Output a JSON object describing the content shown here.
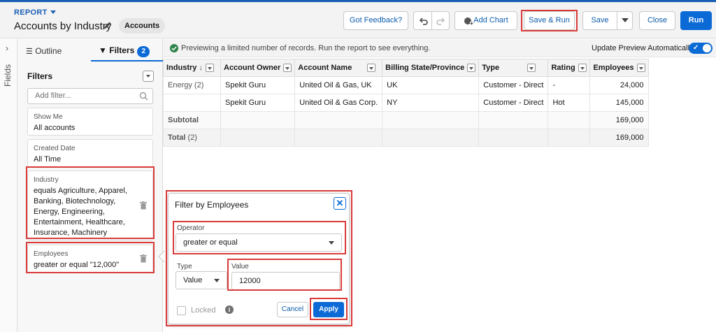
{
  "header": {
    "object_label": "REPORT",
    "title": "Accounts by Industry",
    "report_type": "Accounts",
    "buttons": {
      "feedback": "Got Feedback?",
      "add_chart": "Add Chart",
      "save_run": "Save & Run",
      "save": "Save",
      "close": "Close",
      "run": "Run"
    }
  },
  "rail": {
    "label": "Fields"
  },
  "panel": {
    "tabs": {
      "outline": "Outline",
      "filters": "Filters",
      "filter_count": "2"
    },
    "filters_heading": "Filters",
    "add_filter_placeholder": "Add filter...",
    "cards": [
      {
        "label": "Show Me",
        "value": "All accounts"
      },
      {
        "label": "Created Date",
        "value": "All Time"
      },
      {
        "label": "Industry",
        "value": "equals Agriculture, Apparel, Banking, Biotechnology, Energy, Engineering, Entertainment, Healthcare, Insurance, Machinery"
      },
      {
        "label": "Employees",
        "value": "greater or equal \"12,000\""
      }
    ]
  },
  "preview": {
    "message": "Previewing a limited number of records. Run the report to see everything.",
    "auto_label": "Update Preview Automatically"
  },
  "table": {
    "columns": [
      "Industry",
      "Account Owner",
      "Account Name",
      "Billing State/Province",
      "Type",
      "Rating",
      "Employees"
    ],
    "rows": [
      [
        "Energy (2)",
        "Spekit Guru",
        "United Oil & Gas, UK",
        "UK",
        "Customer - Direct",
        "-",
        "24,000"
      ],
      [
        "",
        "Spekit Guru",
        "United Oil & Gas Corp.",
        "NY",
        "Customer - Direct",
        "Hot",
        "145,000"
      ]
    ],
    "subtotal": {
      "label": "Subtotal",
      "value": "169,000"
    },
    "total": {
      "label": "Total",
      "count": "(2)",
      "value": "169,000"
    }
  },
  "popover": {
    "title": "Filter by Employees",
    "operator_label": "Operator",
    "operator_value": "greater or equal",
    "type_label": "Type",
    "type_value": "Value",
    "value_label": "Value",
    "value_value": "12000",
    "locked_label": "Locked",
    "cancel": "Cancel",
    "apply": "Apply"
  },
  "colors": {
    "brand": "#0b6ad6",
    "highlight": "#d93b3b"
  }
}
